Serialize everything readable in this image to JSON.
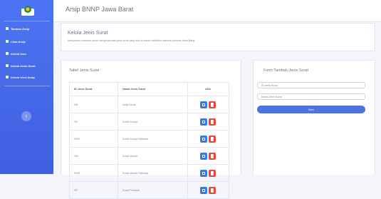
{
  "app": {
    "title": "Arsip BNNP Jawa Barat"
  },
  "sidebar": {
    "items": [
      {
        "label": "Tambah Arsip",
        "icon": "plus-icon"
      },
      {
        "label": "Lihat Arsip",
        "icon": "folder-icon"
      },
      {
        "label": "Kelola User",
        "icon": "users-icon"
      },
      {
        "label": "Kelola Jenis Surat",
        "icon": "file-icon"
      },
      {
        "label": "Kelola Versi Arsip",
        "icon": "layers-icon"
      }
    ],
    "toggle": "‹"
  },
  "header": {
    "title": "Kelola Jenis Surat",
    "description": "Merupakan halaman untuk mengelola data jenis surat yang ada di badan narkotika nasional provinsi Jawa Barat."
  },
  "table": {
    "title": "Tabel Jenis Surat",
    "columns": [
      "ID Jenis Surat",
      "Nama Jenis Surat",
      "Aksi"
    ],
    "rows": [
      {
        "id": "ND",
        "nama": "Nota Dinas"
      },
      {
        "id": "SK",
        "nama": "Surat Keluar"
      },
      {
        "id": "SKR",
        "nama": "Surat Keluar Rahasia"
      },
      {
        "id": "SM",
        "nama": "Surat Masuk"
      },
      {
        "id": "SMR",
        "nama": "Surat Masuk Rahasia"
      },
      {
        "id": "SP",
        "nama": "Surat Perintah"
      }
    ]
  },
  "form": {
    "title": "Form Tambah Jenis Surat",
    "id_placeholder": "ID Jenis Surat",
    "nama_placeholder": "Nama Jenis Surat",
    "submit_label": "Save"
  },
  "colors": {
    "primary": "#4e73df",
    "danger": "#e74a3b",
    "sidebar": "#4c74f2"
  }
}
